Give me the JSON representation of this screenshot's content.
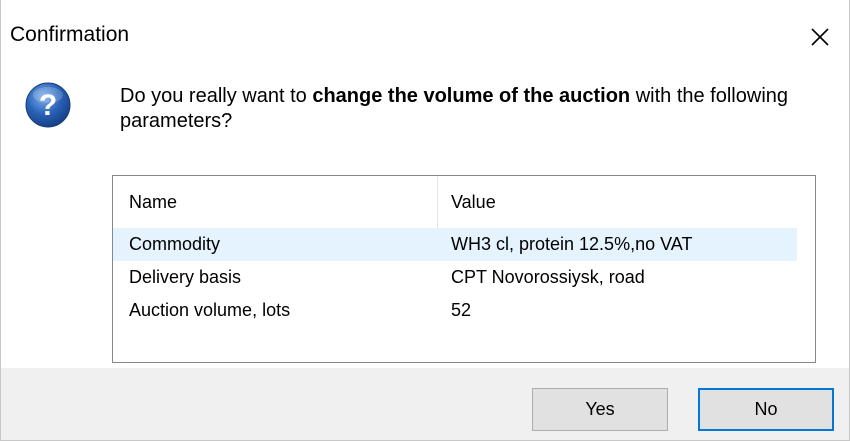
{
  "dialog": {
    "title": "Confirmation",
    "message_prefix": "Do you really want to ",
    "message_bold": "change the volume of the auction",
    "message_suffix": " with the following parameters?",
    "icon": "question-icon"
  },
  "grid": {
    "columns": [
      "Name",
      "Value"
    ],
    "rows": [
      {
        "name": "Commodity",
        "value": "WH3 cl, protein 12.5%,no VAT",
        "selected": true
      },
      {
        "name": "Delivery basis",
        "value": "CPT Novorossiysk, road",
        "selected": false
      },
      {
        "name": "Auction volume, lots",
        "value": "52",
        "selected": false
      }
    ]
  },
  "buttons": {
    "yes": "Yes",
    "no": "No"
  },
  "colors": {
    "selection": "#e5f3ff",
    "default_button_border": "#0078d7",
    "icon_blue": "#1f5aa8"
  }
}
